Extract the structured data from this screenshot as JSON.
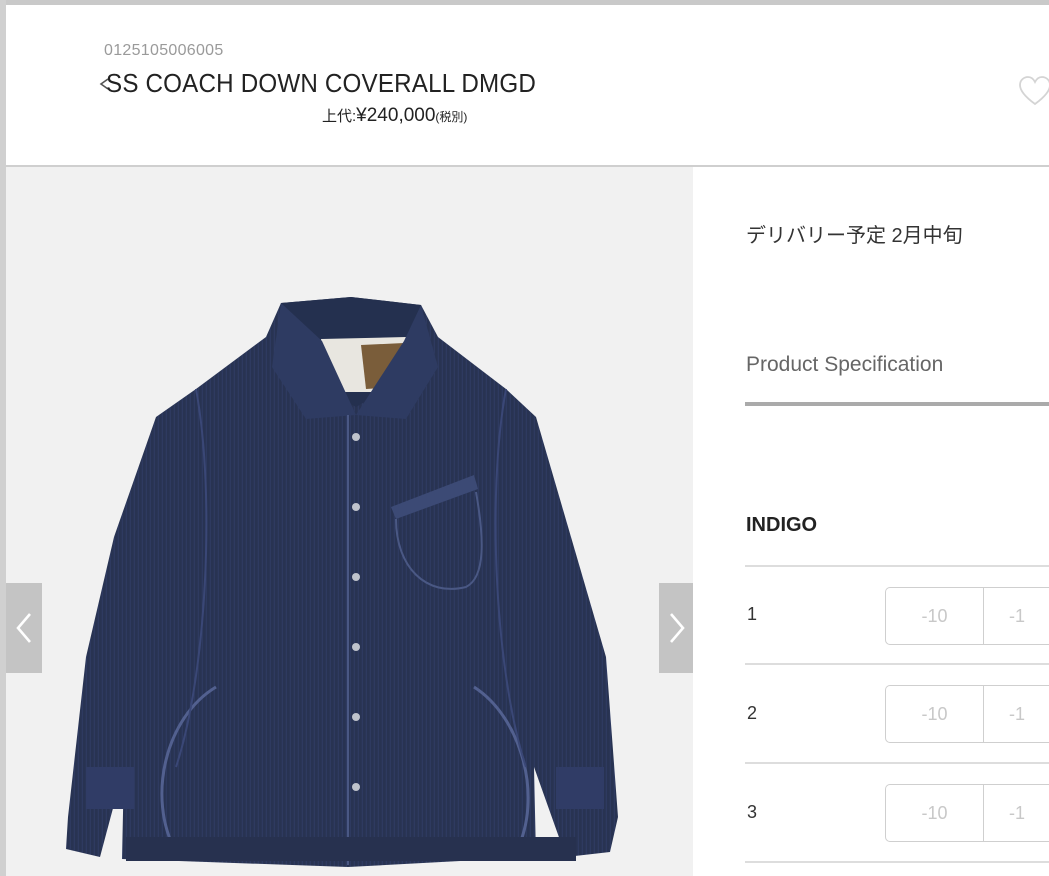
{
  "product": {
    "sku": "0125105006005",
    "title": "SS COACH DOWN COVERALL DMGD",
    "price_label": "上代:",
    "price_value": "¥240,000",
    "price_note": "(税別)"
  },
  "details": {
    "delivery": "デリバリー予定 2月中旬",
    "spec_tab": "Product Specification",
    "color": "INDIGO",
    "sizes": [
      {
        "label": "1",
        "minus10": "-10",
        "minus1": "-1"
      },
      {
        "label": "2",
        "minus10": "-10",
        "minus1": "-1"
      },
      {
        "label": "3",
        "minus10": "-10",
        "minus1": "-1"
      }
    ]
  },
  "icons": {
    "back": "chevron-left-icon",
    "favorite": "heart-icon",
    "prev": "chevron-left-icon",
    "next": "chevron-right-icon"
  },
  "colors": {
    "denim": "#2a3556",
    "arrow_bg": "#c4c4c4",
    "gallery_bg": "#f1f1f1"
  }
}
